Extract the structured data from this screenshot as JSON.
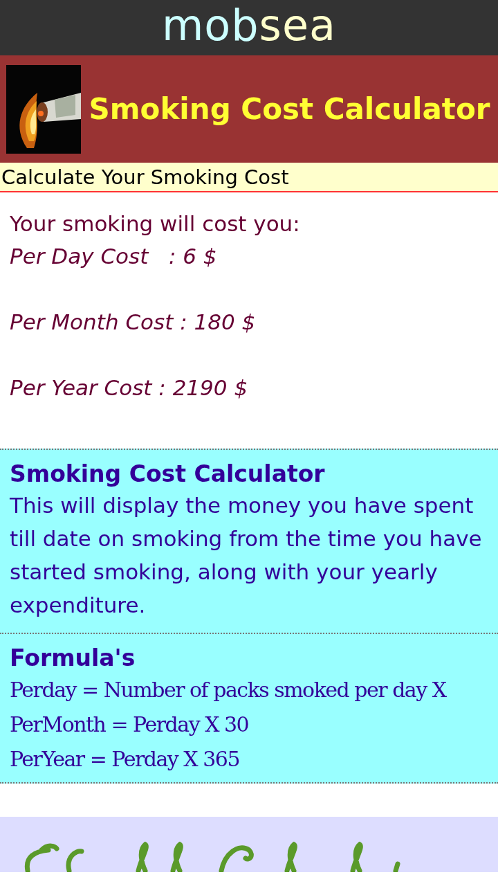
{
  "logo": {
    "parts": [
      {
        "text": "mob",
        "color": "#ccffff"
      },
      {
        "text": "sea",
        "color": "#ffffcc"
      }
    ]
  },
  "header": {
    "kind": "picture",
    "title": "Smoking Cost Calculator"
  },
  "subtitle": "Calculate Your Smoking Cost",
  "results": {
    "intro": "Your smoking will cost you:",
    "lines": [
      "Per Day Cost   : 6 $",
      "Per Month Cost : 180 $",
      "Per Year Cost : 2190 $"
    ]
  },
  "about": {
    "heading": "Smoking Cost Calculator",
    "text": "This will display the money you have spent till date on smoking from the time you have started smoking, along with your yearly expenditure."
  },
  "formulas": {
    "heading": "Formula's",
    "lines": [
      "Perday = Number of packs smoked per day X",
      "PerMonth = Perday X 30",
      "PerYear = Perday X 365"
    ]
  }
}
